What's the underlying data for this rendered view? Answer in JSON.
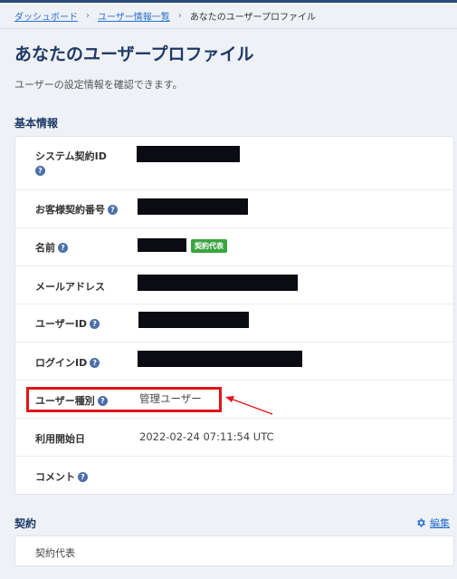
{
  "breadcrumb": {
    "items": [
      "ダッシュボード",
      "ユーザー情報一覧"
    ],
    "current": "あなたのユーザープロファイル",
    "separator": "›"
  },
  "page": {
    "title": "あなたのユーザープロファイル",
    "description": "ユーザーの設定情報を確認できます。"
  },
  "basic_info": {
    "section_title": "基本情報",
    "rows": {
      "system_contract_id": {
        "label": "システム契約ID"
      },
      "customer_contract_no": {
        "label": "お客様契約番号"
      },
      "name": {
        "label": "名前",
        "badge": "契約代表"
      },
      "email": {
        "label": "メールアドレス"
      },
      "user_id": {
        "label": "ユーザーID"
      },
      "login_id": {
        "label": "ログインID"
      },
      "user_type": {
        "label": "ユーザー種別",
        "value": "管理ユーザー"
      },
      "start_date": {
        "label": "利用開始日",
        "value": "2022-02-24 07:11:54 UTC"
      },
      "comment": {
        "label": "コメント"
      }
    },
    "help_glyph": "?"
  },
  "contract": {
    "section_title": "契約",
    "edit_label": "編集",
    "value": "契約代表"
  },
  "colors": {
    "accent": "#1f3a66",
    "link": "#2a6fcf",
    "badge_green": "#3aa53f",
    "annotation_red": "#e0141c"
  }
}
